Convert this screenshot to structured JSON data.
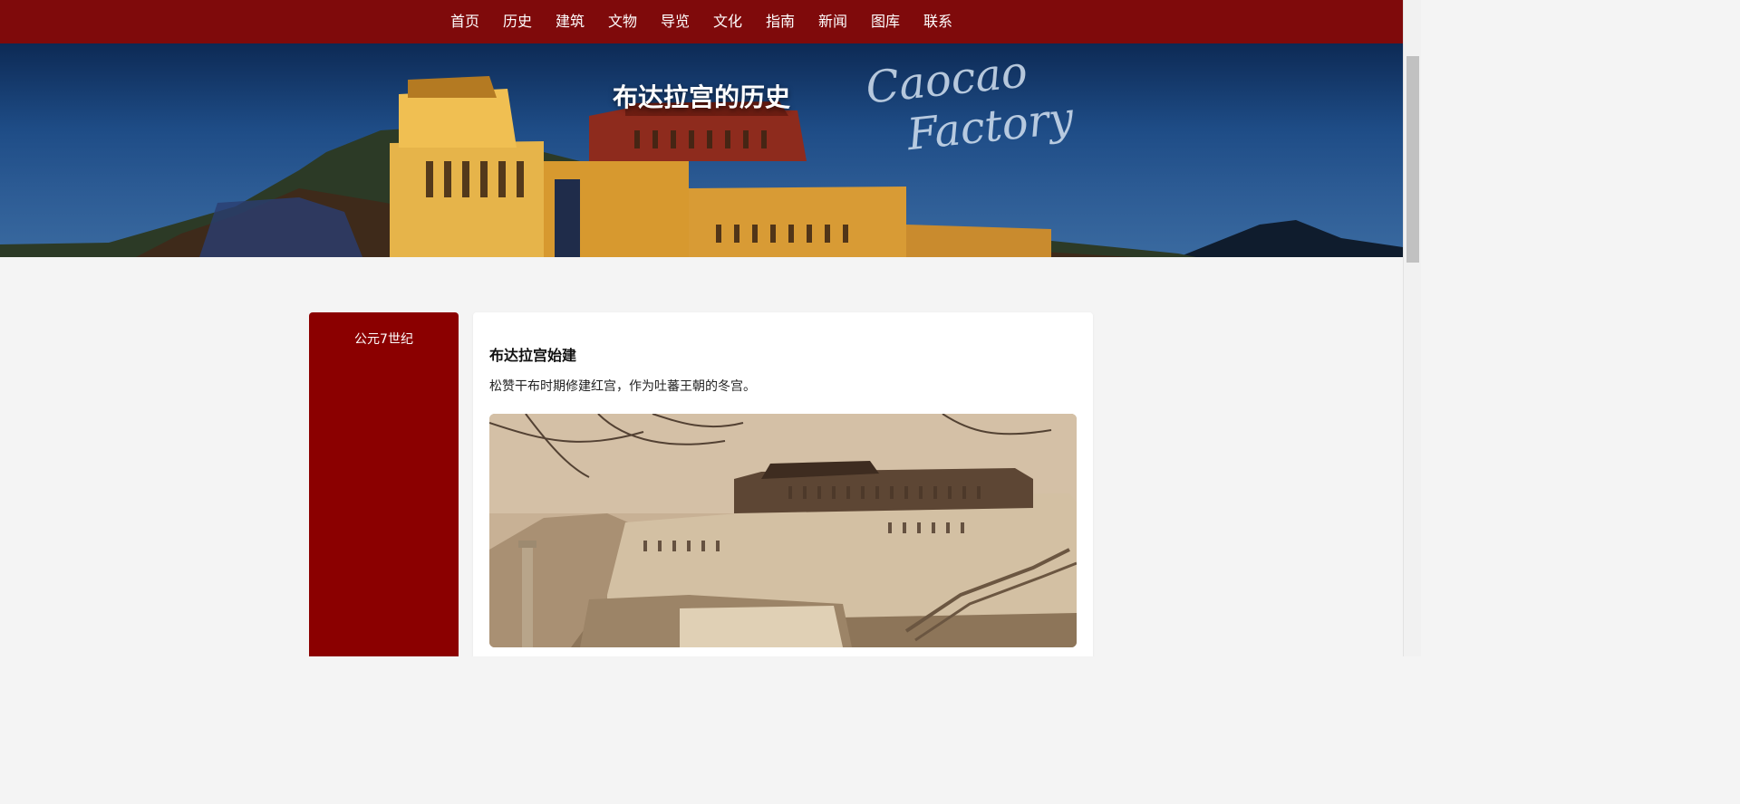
{
  "nav": {
    "items": [
      "首页",
      "历史",
      "建筑",
      "文物",
      "导览",
      "文化",
      "指南",
      "新闻",
      "图库",
      "联系"
    ]
  },
  "hero": {
    "title": "布达拉宫的历史",
    "watermark_line1": "Caocao",
    "watermark_line2": "Factory"
  },
  "timeline": {
    "period": "公元7世纪"
  },
  "entry": {
    "title": "布达拉宫始建",
    "description": "松赞干布时期修建红宫，作为吐蕃王朝的冬宫。"
  },
  "colors": {
    "nav_bg": "#7f0a0b",
    "timeline_bg": "#8b0000",
    "page_bg": "#f4f4f4"
  }
}
